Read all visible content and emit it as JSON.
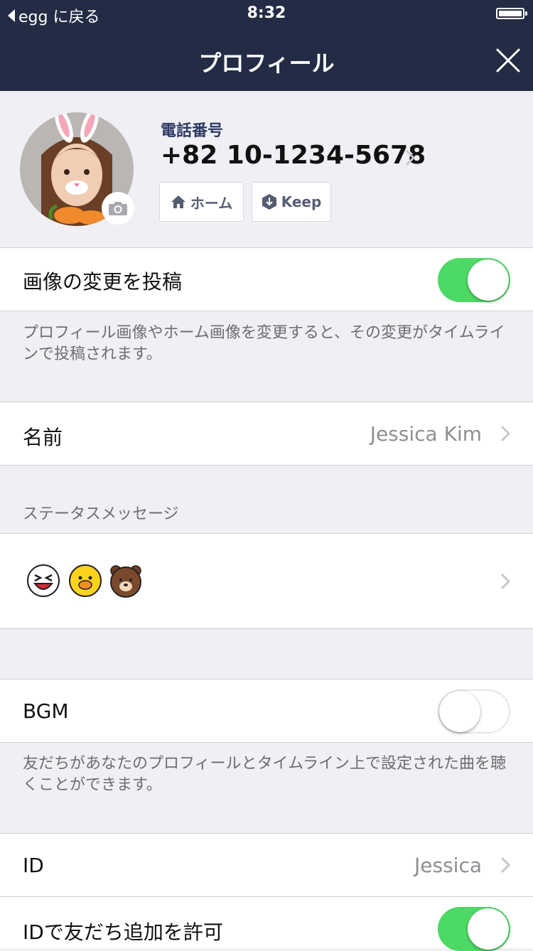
{
  "status_bar": {
    "back_label": "egg に戻る",
    "time": "8:32"
  },
  "nav": {
    "title": "プロフィール"
  },
  "profile": {
    "phone_label": "電話番号",
    "phone_number": "+82 10-1234-5678",
    "home_button": "ホーム",
    "keep_button": "Keep"
  },
  "settings": {
    "post_image_change": {
      "label": "画像の変更を投稿",
      "enabled": true
    },
    "post_image_note": "プロフィール画像やホーム画像を変更すると、その変更がタイムラインで投稿されます。",
    "name": {
      "label": "名前",
      "value": "Jessica Kim"
    },
    "status_message_header": "ステータスメッセージ",
    "status_message_stickers": [
      "face-sticker-icon",
      "chick-sticker-icon",
      "bear-sticker-icon"
    ],
    "bgm": {
      "label": "BGM",
      "enabled": false
    },
    "bgm_note": "友だちがあなたのプロフィールとタイムライン上で設定された曲を聴くことができます。",
    "id": {
      "label": "ID",
      "value": "Jessica"
    },
    "allow_add_by_id": {
      "label": "IDで友だち追加を許可",
      "enabled": true
    }
  },
  "colors": {
    "nav_bg": "#232c44",
    "toggle_on": "#4cd964",
    "phone_label": "#2c3a63"
  }
}
